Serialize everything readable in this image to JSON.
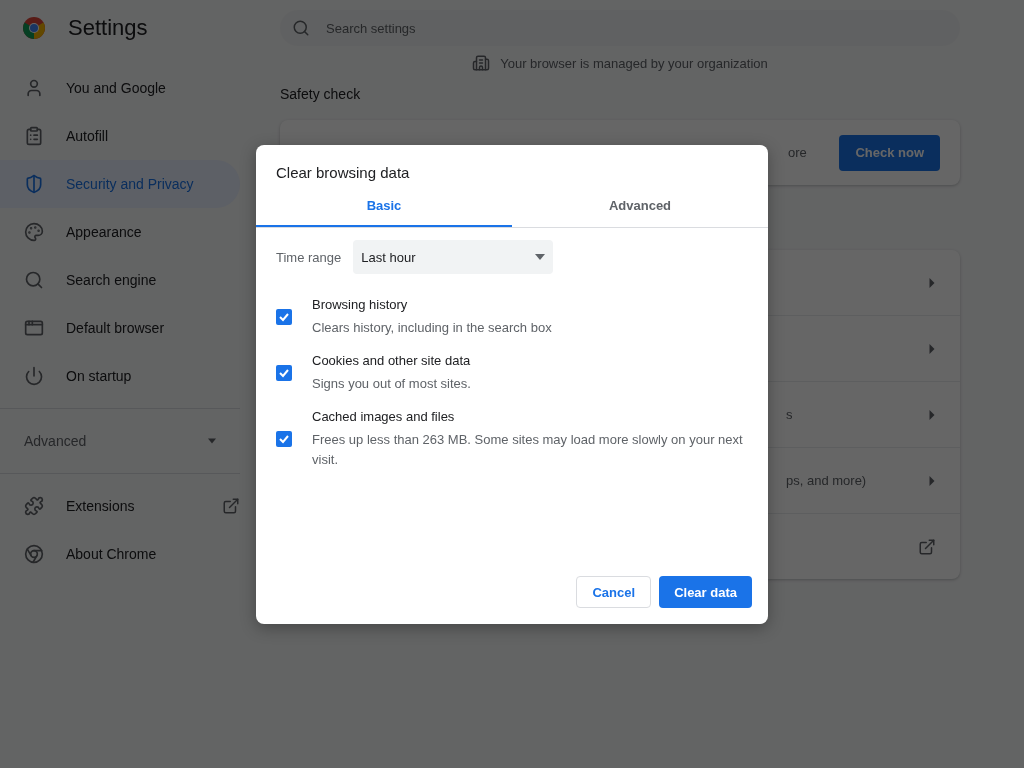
{
  "header": {
    "title": "Settings",
    "search": {
      "placeholder": "Search settings"
    }
  },
  "sidebar": {
    "items": [
      {
        "label": "You and Google",
        "selected": false
      },
      {
        "label": "Autofill",
        "selected": false
      },
      {
        "label": "Security and Privacy",
        "selected": true
      },
      {
        "label": "Appearance",
        "selected": false
      },
      {
        "label": "Search engine",
        "selected": false
      },
      {
        "label": "Default browser",
        "selected": false
      },
      {
        "label": "On startup",
        "selected": false
      }
    ],
    "advanced": {
      "label": "Advanced",
      "expanded": false
    },
    "extra_items": [
      {
        "label": "Extensions",
        "kind": "external"
      },
      {
        "label": "About Chrome",
        "kind": "plain"
      }
    ]
  },
  "main": {
    "managed_notice": "Your browser is managed by your organization",
    "safety_check": {
      "title": "Safety check",
      "text_fragment": "ore",
      "button": "Check now"
    },
    "privacy_rows": [
      {
        "kind": "arrow",
        "text_fragment": ""
      },
      {
        "kind": "arrow",
        "text_fragment": ""
      },
      {
        "kind": "arrow",
        "text_fragment": "s"
      },
      {
        "kind": "arrow",
        "text_fragment": "ps, and more)"
      },
      {
        "kind": "external",
        "text_fragment": ""
      }
    ]
  },
  "dialog": {
    "title": "Clear browsing data",
    "tabs": [
      {
        "label": "Basic",
        "selected": true
      },
      {
        "label": "Advanced",
        "selected": false
      }
    ],
    "time_range": {
      "label": "Time range",
      "value": "Last hour"
    },
    "options": [
      {
        "label": "Browsing history",
        "description": "Clears history, including in the search box",
        "checked": true
      },
      {
        "label": "Cookies and other site data",
        "description": "Signs you out of most sites.",
        "checked": true
      },
      {
        "label": "Cached images and files",
        "description": "Frees up less than 263 MB. Some sites may load more slowly on your next visit.",
        "checked": true
      }
    ],
    "buttons": [
      {
        "label": "Cancel",
        "kind": "secondary"
      },
      {
        "label": "Clear data",
        "kind": "primary"
      }
    ]
  }
}
